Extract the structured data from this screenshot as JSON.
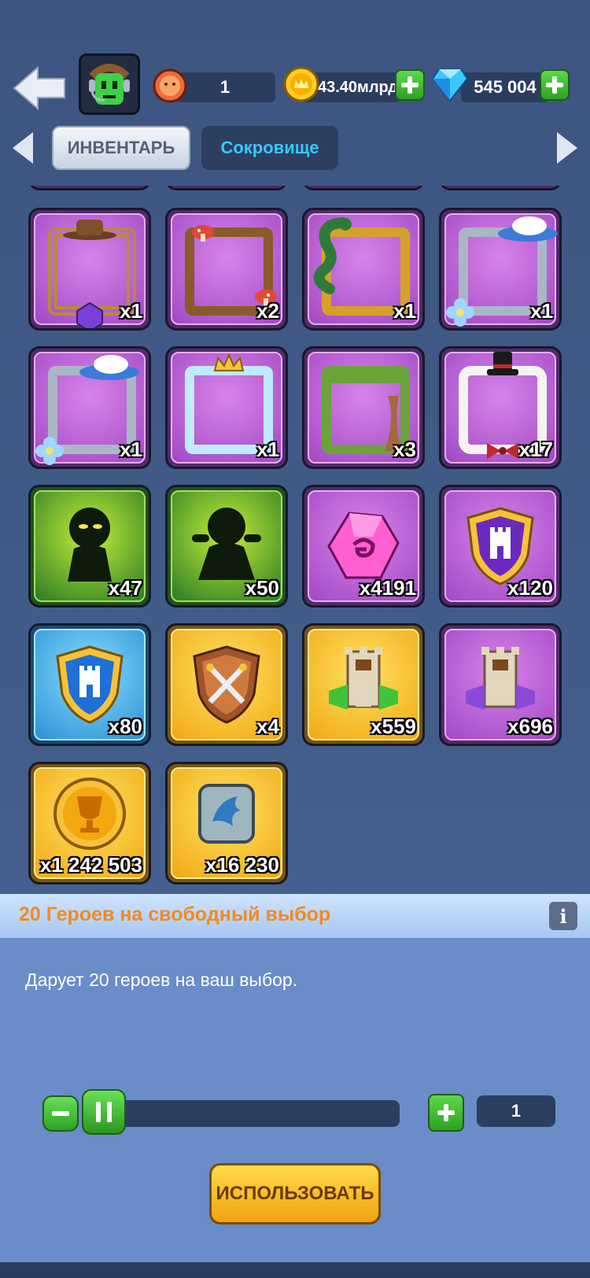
{
  "header": {
    "level_value": "1",
    "gold_value": "43.40млрд",
    "gems_value": "545 004"
  },
  "tabs": [
    {
      "label": "ИНВЕНТАРЬ",
      "active": true
    },
    {
      "label": "Сокровище",
      "active": false
    }
  ],
  "inventory": {
    "items": [
      {
        "name": "steampunk-frame",
        "count": "x1"
      },
      {
        "name": "mushroom-frame",
        "count": "x2"
      },
      {
        "name": "serpent-frame",
        "count": "x1"
      },
      {
        "name": "flower-hat-frame",
        "count": "x1"
      },
      {
        "name": "flower-hat-frame-2",
        "count": "x1"
      },
      {
        "name": "ice-frame",
        "count": "x1"
      },
      {
        "name": "tree-frame",
        "count": "x3"
      },
      {
        "name": "tuxedo-frame",
        "count": "x17"
      },
      {
        "name": "shadow-hero-card-1",
        "count": "x47"
      },
      {
        "name": "shadow-hero-card-2",
        "count": "x50"
      },
      {
        "name": "purple-gem",
        "count": "x4191"
      },
      {
        "name": "purple-tower-shield",
        "count": "x120"
      },
      {
        "name": "blue-tower-shield",
        "count": "x80"
      },
      {
        "name": "crossed-swords-shield",
        "count": "x4"
      },
      {
        "name": "green-tower-chest",
        "count": "x559"
      },
      {
        "name": "purple-tower-chest",
        "count": "x696"
      },
      {
        "name": "trophy-coin",
        "count": "x1 242 503"
      },
      {
        "name": "dragon-stone",
        "count": "x16 230"
      }
    ]
  },
  "detail": {
    "title": "20 Героев на свободный выбор",
    "info_label": "i",
    "description": "Дарует 20 героев на ваш выбор.",
    "quantity": "1",
    "use_label": "ИСПОЛЬЗОВАТЬ"
  },
  "colors": {
    "background": "#405a87",
    "accent_orange": "#f18b1c",
    "tab_active_text": "#51627a",
    "tab_inactive_text": "#37c8ff",
    "button_yellow": "#f1a40f",
    "plus_green": "#2ea124"
  }
}
